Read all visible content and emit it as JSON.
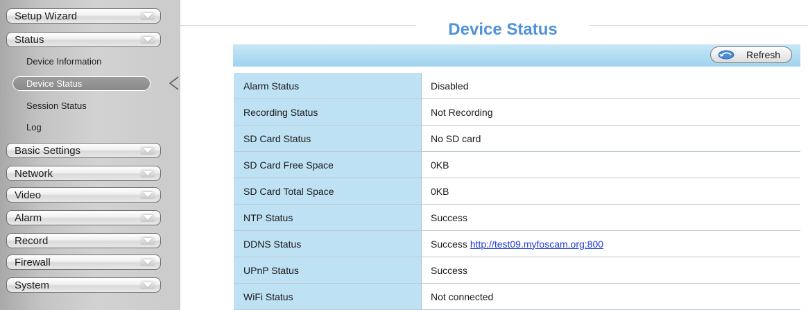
{
  "sidebar": {
    "setup_wizard": "Setup Wizard",
    "status": "Status",
    "status_items": {
      "device_information": "Device Information",
      "device_status": "Device Status",
      "session_status": "Session Status",
      "log": "Log"
    },
    "basic_settings": "Basic Settings",
    "network": "Network",
    "video": "Video",
    "alarm": "Alarm",
    "record": "Record",
    "firewall": "Firewall",
    "system": "System"
  },
  "page": {
    "title": "Device Status",
    "refresh_label": "Refresh"
  },
  "status_table": {
    "rows": [
      {
        "label": "Alarm Status",
        "value": "Disabled"
      },
      {
        "label": "Recording Status",
        "value": "Not Recording"
      },
      {
        "label": "SD Card Status",
        "value": "No SD card"
      },
      {
        "label": "SD Card Free Space",
        "value": "0KB"
      },
      {
        "label": "SD Card Total Space",
        "value": "0KB"
      },
      {
        "label": "NTP Status",
        "value": "Success"
      },
      {
        "label": "DDNS Status",
        "value": "Success",
        "link": "http://test09.myfoscam.org:800"
      },
      {
        "label": "UPnP Status",
        "value": "Success"
      },
      {
        "label": "WiFi Status",
        "value": "Not connected"
      }
    ]
  },
  "colors": {
    "title": "#4f93d8",
    "label_cell": "#bfe1f4",
    "toolbar": "#a7d7f0",
    "link": "#1f3bd1"
  },
  "icons": {
    "menu_toggle": "chevron-down-icon",
    "refresh": "refresh-icon",
    "active_pointer": "pointer-icon"
  }
}
